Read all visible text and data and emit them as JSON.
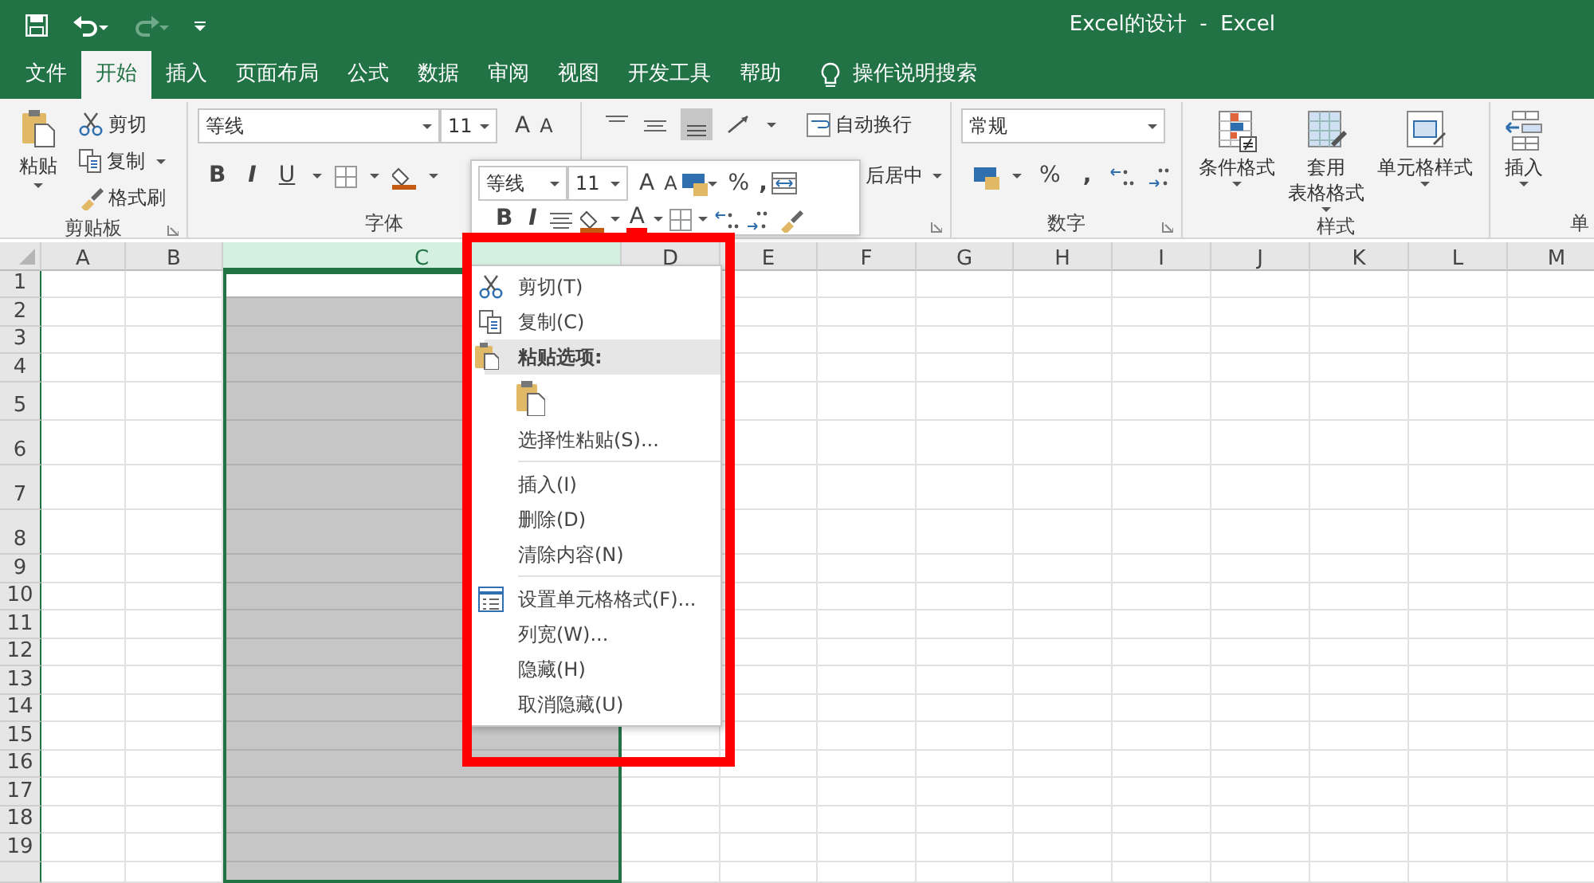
{
  "quick_access": [
    {
      "kind": "save",
      "disabled": false
    },
    {
      "kind": "undo",
      "disabled": false
    },
    {
      "kind": "redo",
      "disabled": true
    },
    {
      "kind": "customize",
      "disabled": false
    }
  ],
  "window": {
    "title": "Excel的设计  -  Excel"
  },
  "tabs": [
    {
      "label": "文件",
      "selected": false
    },
    {
      "label": "开始",
      "selected": true
    },
    {
      "label": "插入",
      "selected": false
    },
    {
      "label": "页面布局",
      "selected": false
    },
    {
      "label": "公式",
      "selected": false
    },
    {
      "label": "数据",
      "selected": false
    },
    {
      "label": "审阅",
      "selected": false
    },
    {
      "label": "视图",
      "selected": false
    },
    {
      "label": "开发工具",
      "selected": false
    },
    {
      "label": "帮助",
      "selected": false
    }
  ],
  "tell_me": {
    "label": "操作说明搜索"
  },
  "ribbon": {
    "clipboard": {
      "paste": "粘贴",
      "cut": "剪切",
      "copy": "复制",
      "format_painter": "格式刷",
      "label": "剪贴板"
    },
    "font": {
      "font_name": "等线",
      "font_size": "11",
      "grow_font": "A",
      "shrink_font": "A",
      "bold": "B",
      "italic": "I",
      "underline": "U",
      "label": "字体"
    },
    "alignment": {
      "wrap_text": "自动换行",
      "merge": "后居中"
    },
    "number": {
      "format": "常规",
      "percent": "%",
      "comma": ",",
      "label": "数字"
    },
    "styles": {
      "conditional": "条件格式",
      "table_format": [
        "套用",
        "表格格式"
      ],
      "cell_styles": "单元格样式",
      "label": "样式"
    },
    "cells": {
      "insert": "插入",
      "label": "单"
    }
  },
  "mini_toolbar": {
    "font_name": "等线",
    "font_size": "11",
    "grow_font": "A",
    "shrink_font": "A",
    "percent": "%",
    "comma": ",",
    "bold": "B",
    "italic": "I",
    "font_color": "A"
  },
  "sheet": {
    "columns": [
      {
        "label": "A",
        "selected": false
      },
      {
        "label": "B",
        "selected": false
      },
      {
        "label": "C",
        "selected": true
      },
      {
        "label": "D",
        "selected": false
      },
      {
        "label": "E",
        "selected": false
      },
      {
        "label": "F",
        "selected": false
      },
      {
        "label": "G",
        "selected": false
      },
      {
        "label": "H",
        "selected": false
      },
      {
        "label": "I",
        "selected": false
      },
      {
        "label": "J",
        "selected": false
      },
      {
        "label": "K",
        "selected": false
      },
      {
        "label": "L",
        "selected": false
      },
      {
        "label": "M",
        "selected": false
      }
    ],
    "rows": [
      "1",
      "2",
      "3",
      "4",
      "5",
      "6",
      "7",
      "8",
      "9",
      "10",
      "11",
      "12",
      "13",
      "14",
      "15",
      "16",
      "17",
      "18",
      "19"
    ]
  },
  "context_menu": [
    {
      "kind": "cut",
      "label": "剪切(T)"
    },
    {
      "kind": "copy",
      "label": "复制(C)"
    },
    {
      "kind": "header",
      "label": "粘贴选项:"
    },
    {
      "kind": "paste_option"
    },
    {
      "kind": "item",
      "label": "选择性粘贴(S)..."
    },
    {
      "kind": "separator"
    },
    {
      "kind": "item",
      "label": "插入(I)"
    },
    {
      "kind": "item",
      "label": "删除(D)"
    },
    {
      "kind": "item",
      "label": "清除内容(N)"
    },
    {
      "kind": "separator"
    },
    {
      "kind": "format_cells",
      "label": "设置单元格格式(F)..."
    },
    {
      "kind": "item",
      "label": "列宽(W)..."
    },
    {
      "kind": "item",
      "label": "隐藏(H)"
    },
    {
      "kind": "item",
      "label": "取消隐藏(U)"
    }
  ],
  "highlight": {
    "kind": "frame"
  }
}
